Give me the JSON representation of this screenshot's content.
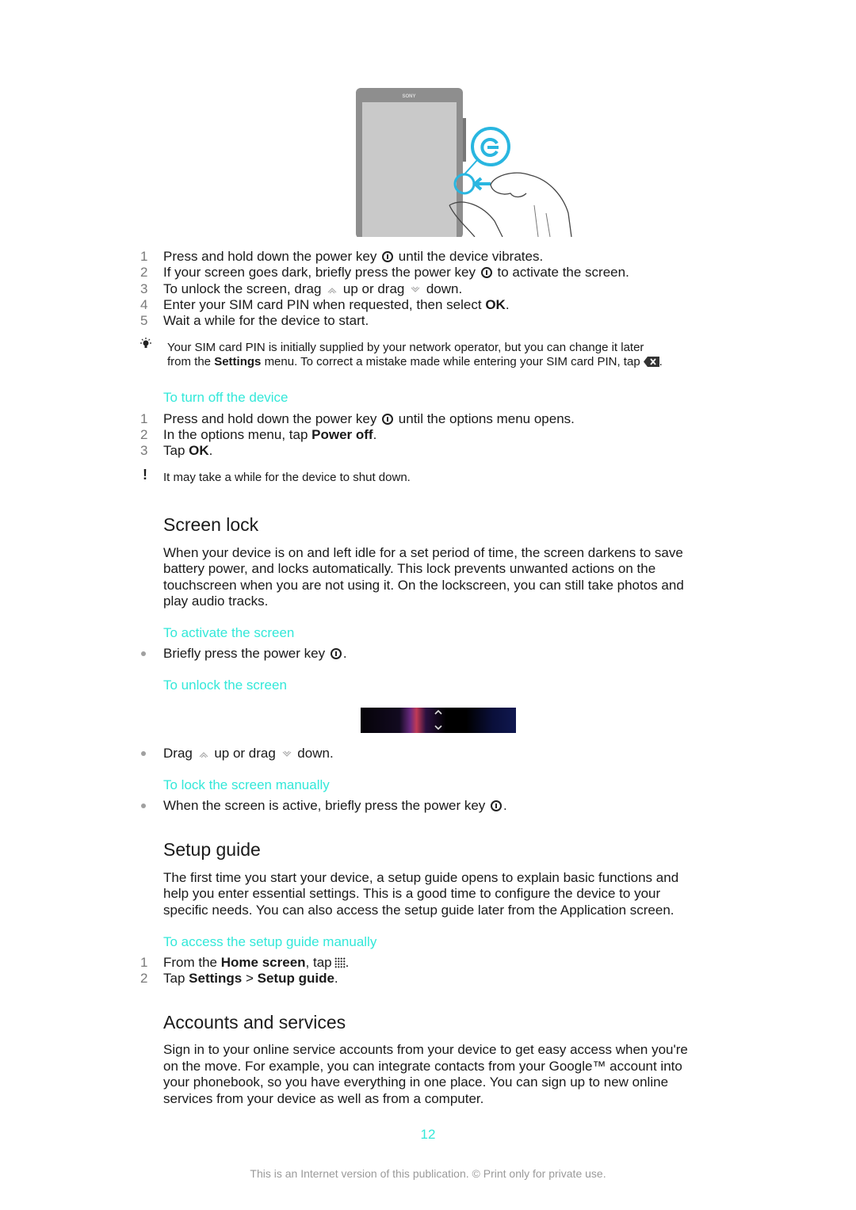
{
  "illustration": {
    "brand": "SONY",
    "accent": "#29b6e0"
  },
  "turn_on_steps": [
    {
      "n": "1",
      "before": "Press and hold down the power key",
      "after": "until the device vibrates."
    },
    {
      "n": "2",
      "before": "If your screen goes dark, briefly press the power key",
      "after": "to activate the screen."
    },
    {
      "n": "3",
      "before": "To unlock the screen, drag",
      "mid": "up or drag",
      "after": "down."
    },
    {
      "n": "4",
      "before": "Enter your SIM card PIN when requested, then select",
      "bold": "OK",
      "after": "."
    },
    {
      "n": "5",
      "text": "Wait a while for the device to start."
    }
  ],
  "tip": {
    "icon": "lightbulb-icon",
    "line1": "Your SIM card PIN is initially supplied by your network operator, but you can change it later",
    "line2_before": "from the",
    "line2_bold": "Settings",
    "line2_after": "menu. To correct a mistake made while entering your SIM card PIN, tap",
    "line2_end": "."
  },
  "turn_off": {
    "heading": "To turn off the device",
    "steps": [
      {
        "n": "1",
        "before": "Press and hold down the power key",
        "after": "until the options menu opens."
      },
      {
        "n": "2",
        "before": "In the options menu, tap",
        "bold": "Power off",
        "after": "."
      },
      {
        "n": "3",
        "before": "Tap",
        "bold": "OK",
        "after": "."
      }
    ],
    "warning": "It may take a while for the device to shut down."
  },
  "screen_lock": {
    "title": "Screen lock",
    "paragraph": [
      "When your device is on and left idle for a set period of time, the screen darkens to save",
      "battery power, and locks automatically. This lock prevents unwanted actions on the",
      "touchscreen when you are not using it. On the lockscreen, you can still take photos and",
      "play audio tracks."
    ],
    "activate_heading": "To activate the screen",
    "activate_before": "Briefly press the power key",
    "activate_after": ".",
    "unlock_heading": "To unlock the screen",
    "unlock_before": "Drag",
    "unlock_mid": "up or drag",
    "unlock_after": "down.",
    "lock_heading": "To lock the screen manually",
    "lock_before": "When the screen is active, briefly press the power key",
    "lock_after": "."
  },
  "setup_guide": {
    "title": "Setup guide",
    "paragraph": [
      "The first time you start your device, a setup guide opens to explain basic functions and",
      "help you enter essential settings. This is a good time to configure the device to your",
      "specific needs. You can also access the setup guide later from the Application screen."
    ],
    "heading": "To access the setup guide manually",
    "step1": {
      "n": "1",
      "before": "From the",
      "bold": "Home screen",
      "after": ", tap",
      "end": "."
    },
    "step2": {
      "n": "2",
      "before": "Tap",
      "bold1": "Settings",
      "sep": ">",
      "bold2": "Setup guide",
      "end": "."
    }
  },
  "accounts": {
    "title": "Accounts and services",
    "paragraph": [
      "Sign in to your online service accounts from your device to get easy access when you're",
      "on the move. For example, you can integrate contacts from your Google™ account into",
      "your phonebook, so you have everything in one place. You can sign up to new online",
      "services from your device as well as from a computer."
    ]
  },
  "page_number": "12",
  "footer": "This is an Internet version of this publication. © Print only for private use.",
  "colors": {
    "heading_teal": "#33e8d9",
    "step_number": "#7a7a7a"
  }
}
